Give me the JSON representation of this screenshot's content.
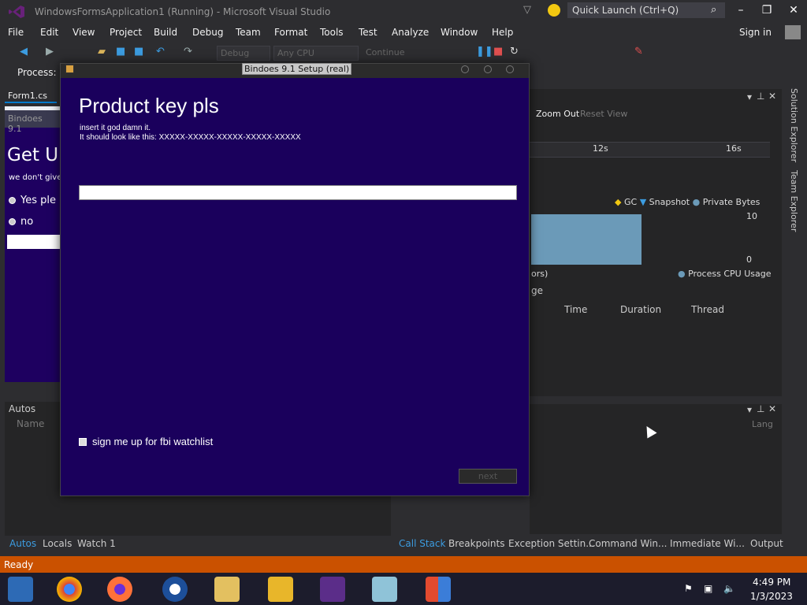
{
  "window": {
    "title": "WindowsFormsApplication1 (Running) - Microsoft Visual Studio",
    "quick_launch_placeholder": "Quick Launch (Ctrl+Q)"
  },
  "menu": [
    "File",
    "Edit",
    "View",
    "Project",
    "Build",
    "Debug",
    "Team",
    "Format",
    "Tools",
    "Test",
    "Analyze",
    "Window",
    "Help"
  ],
  "signin": "Sign in",
  "toolbar": {
    "config": "Debug",
    "platform": "Any CPU",
    "continue": "Continue",
    "process_label": "Process:"
  },
  "editor": {
    "tab": "Form1.cs",
    "preview_title": "Bindoes 9.1",
    "heading": "Get U",
    "subtitle": "we don't give",
    "option_yes": "Yes ple",
    "option_no": "no"
  },
  "autos": {
    "title": "Autos",
    "col_name": "Name",
    "tabs": [
      "Autos",
      "Locals",
      "Watch 1"
    ]
  },
  "diagnostics": {
    "zoom_out": "Zoom Out",
    "reset_view": "Reset View",
    "tick_12": "12s",
    "tick_16": "16s",
    "legend": {
      "gc": "GC",
      "snapshot": "Snapshot",
      "private_bytes": "Private Bytes"
    },
    "y_max": "10",
    "y_min": "0",
    "cpu_header_fragment": "ors)",
    "cpu_legend": "Process CPU Usage",
    "events_fragment": "ge",
    "columns": [
      "Time",
      "Duration",
      "Thread"
    ],
    "lang_col": "Lang"
  },
  "bottom_tabs": [
    "Call Stack",
    "Breakpoints",
    "Exception Settin...",
    "Command Win...",
    "Immediate Wi...",
    "Output"
  ],
  "side_tabs": [
    "Solution Explorer",
    "Team Explorer"
  ],
  "status": "Ready",
  "dialog": {
    "title": "Bindoes 9.1 Setup (real)",
    "heading": "Product key pls",
    "line1": "insert it god damn it.",
    "line2": "It should look like this: XXXXX-XXXXX-XXXXX-XXXXX-XXXXX",
    "input_value": "",
    "checkbox_label": "sign me up for fbi watchlist",
    "next_label": "next"
  },
  "taskbar": {
    "time": "4:49 PM",
    "date": "1/3/2023"
  },
  "colors": {
    "accent": "#007acc",
    "status_bar": "#ca5100",
    "dialog_bg": "#1a005c"
  }
}
